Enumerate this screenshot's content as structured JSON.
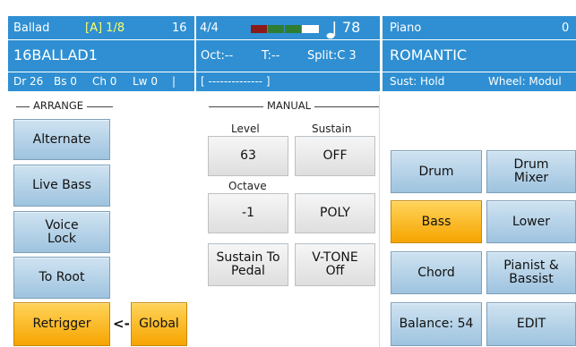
{
  "header": {
    "left": {
      "style_category": "Ballad",
      "variation": "[A] 1/8",
      "measure": "16",
      "style_name": "16BALLAD1",
      "dr": "Dr 26",
      "bs": "Bs 0",
      "ch": "Ch 0",
      "lw": "Lw 0"
    },
    "mid": {
      "time_sig": "4/4",
      "tempo": "78",
      "oct": "Oct:--",
      "transpose": "T:--",
      "split": "Split:C 3",
      "bracket": "[ -------------- ]"
    },
    "right": {
      "category": "Piano",
      "value": "0",
      "sound_name": "ROMANTIC",
      "sustain": "Sust: Hold",
      "wheel": "Wheel: Modul"
    },
    "colors": {
      "panel_blue": "#2f8fd2",
      "meter_red": "#8b1a1a",
      "meter_green": "#2e7d32",
      "meter_white": "#ffffff"
    }
  },
  "arrange": {
    "title": "ARRANGE",
    "buttons": {
      "alternate": "Alternate",
      "live_bass": "Live Bass",
      "voice_lock": "Voice Lock",
      "to_root": "To Root",
      "retrigger": "Retrigger",
      "arrow": "<-",
      "global": "Global"
    }
  },
  "manual": {
    "title": "MANUAL",
    "level_label": "Level",
    "level_value": "63",
    "sustain_label": "Sustain",
    "sustain_value": "OFF",
    "octave_label": "Octave",
    "octave_value": "-1",
    "poly_value": "POLY",
    "sustain_pedal": "Sustain To Pedal",
    "vtone": "V-TONE Off"
  },
  "right_panel": {
    "drum": "Drum",
    "drum_mixer": "Drum Mixer",
    "bass": "Bass",
    "lower": "Lower",
    "chord": "Chord",
    "pianist_bassist": "Pianist & Bassist",
    "balance": "Balance: 54",
    "edit": "EDIT"
  }
}
